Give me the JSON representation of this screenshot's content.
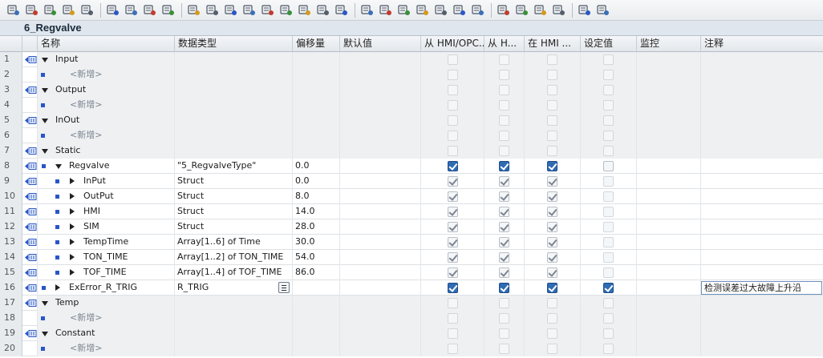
{
  "title": "6_Regvalve",
  "columns": {
    "name": "名称",
    "datatype": "数据类型",
    "offset": "偏移量",
    "default": "默认值",
    "hmi_opc": "从 HMI/OPC...",
    "from_h": "从 H...",
    "in_hmi": "在 HMI ...",
    "setpoint": "设定值",
    "monitor": "监控",
    "comment": "注释"
  },
  "rows": [
    {
      "num": "1",
      "name": "Input"
    },
    {
      "num": "2",
      "name": "<新增>"
    },
    {
      "num": "3",
      "name": "Output"
    },
    {
      "num": "4",
      "name": "<新增>"
    },
    {
      "num": "5",
      "name": "InOut"
    },
    {
      "num": "6",
      "name": "<新增>"
    },
    {
      "num": "7",
      "name": "Static"
    },
    {
      "num": "8",
      "name": "Regvalve",
      "datatype": "\"5_RegvalveType\"",
      "offset": "0.0"
    },
    {
      "num": "9",
      "name": "InPut",
      "datatype": "Struct",
      "offset": "0.0"
    },
    {
      "num": "10",
      "name": "OutPut",
      "datatype": "Struct",
      "offset": "8.0"
    },
    {
      "num": "11",
      "name": "HMI",
      "datatype": "Struct",
      "offset": "14.0"
    },
    {
      "num": "12",
      "name": "SIM",
      "datatype": "Struct",
      "offset": "28.0"
    },
    {
      "num": "13",
      "name": "TempTime",
      "datatype": "Array[1..6] of Time",
      "offset": "30.0"
    },
    {
      "num": "14",
      "name": "TON_TIME",
      "datatype": "Array[1..2] of TON_TIME",
      "offset": "54.0"
    },
    {
      "num": "15",
      "name": "TOF_TIME",
      "datatype": "Array[1..4] of TOF_TIME",
      "offset": "86.0"
    },
    {
      "num": "16",
      "name": "ExError_R_TRIG",
      "datatype": "R_TRIG",
      "comment": "检测误差过大故障上升沿"
    },
    {
      "num": "17",
      "name": "Temp"
    },
    {
      "num": "18",
      "name": "<新增>"
    },
    {
      "num": "19",
      "name": "Constant"
    },
    {
      "num": "20",
      "name": "<新增>"
    }
  ],
  "colors": {
    "accent": "#2f6bb5",
    "rownum_bg": "#e8ebee",
    "title_bg": "#dfe6ee"
  },
  "icons": {
    "toolbar": [
      "insert-row-icon",
      "delete-row-icon",
      "add-row-icon",
      "add-row-below-icon",
      "monitor-icon",
      "expand-all-icon",
      "collapse-all-icon",
      "view-icon",
      "comment-icon",
      "download-icon",
      "upload-icon",
      "snapshot-icon",
      "list-icon",
      "settings-icon",
      "compare-icon",
      "sync-icon",
      "reset-icon",
      "filter-icon",
      "check-icon",
      "indent-icon",
      "outdent-icon",
      "align-icon",
      "grid-icon",
      "tree-icon",
      "branch-icon",
      "link-icon",
      "unlink-icon",
      "refresh-icon",
      "watch-icon",
      "glasses-icon",
      "database-icon"
    ]
  }
}
